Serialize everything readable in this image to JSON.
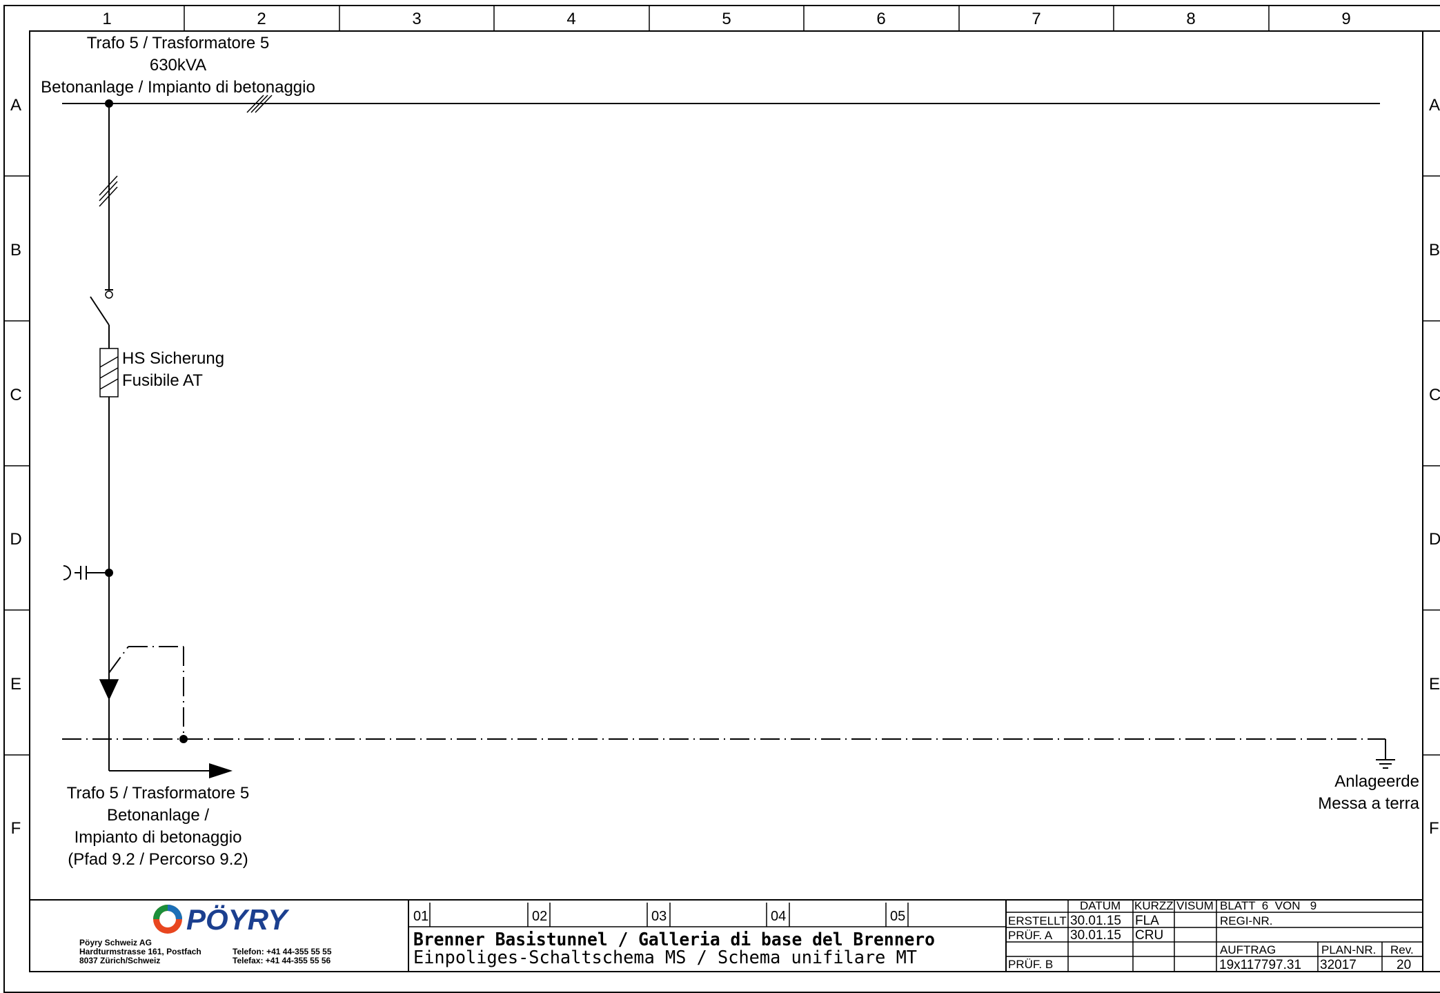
{
  "grid": {
    "columns": [
      "1",
      "2",
      "3",
      "4",
      "5",
      "6",
      "7",
      "8",
      "9"
    ],
    "rows": [
      "A",
      "B",
      "C",
      "D",
      "E",
      "F"
    ]
  },
  "busbar": {
    "label_line1": "Trafo 5 / Trasformatore 5",
    "label_line2": "630kVA",
    "label_line3": "Betonanlage / Impianto di betonaggio"
  },
  "fuse": {
    "line1": "HS Sicherung",
    "line2": "Fusibile AT"
  },
  "outgoing": {
    "line1": "Trafo 5 / Trasformatore 5",
    "line2": "Betonanlage /",
    "line3": "Impianto di betonaggio",
    "line4": "(Pfad 9.2 / Percorso 9.2)"
  },
  "earth": {
    "line1": "Anlageerde",
    "line2": "Messa a terra"
  },
  "title_block": {
    "logo_text": "PÖYRY",
    "company_name": "Pöyry Schweiz AG",
    "address_line1": "Hardturmstrasse 161, Postfach",
    "address_line2": "8037 Zürich/Schweiz",
    "phone": "Telefon: +41 44-355 55 55",
    "fax": "Telefax: +41 44-355 55 56",
    "rev_slots": [
      "01",
      "02",
      "03",
      "04",
      "05"
    ],
    "project_title": "Brenner Basistunnel / Galleria di base del Brennero",
    "drawing_title": "Einpoliges-Schaltschema MS / Schema unifilare MT",
    "hdr_datum": "DATUM",
    "hdr_kurzz": "KURZZ",
    "hdr_visum": "VISUM",
    "lbl_erstellt": "ERSTELLT",
    "lbl_pruef_a": "PRÜF. A",
    "lbl_pruef_b": "PRÜF. B",
    "erstellt_datum": "30.01.15",
    "erstellt_kurzz": "FLA",
    "pruef_a_datum": "30.01.15",
    "pruef_a_kurzz": "CRU",
    "blatt": "BLATT  6  VON   9",
    "regi_nr": "REGI-NR.",
    "auftrag_label": "AUFTRAG",
    "plan_nr_label": "PLAN-NR.",
    "rev_label": "Rev.",
    "auftrag_value": "19x117797.31",
    "plan_nr_value": "32017",
    "rev_value": "20"
  }
}
